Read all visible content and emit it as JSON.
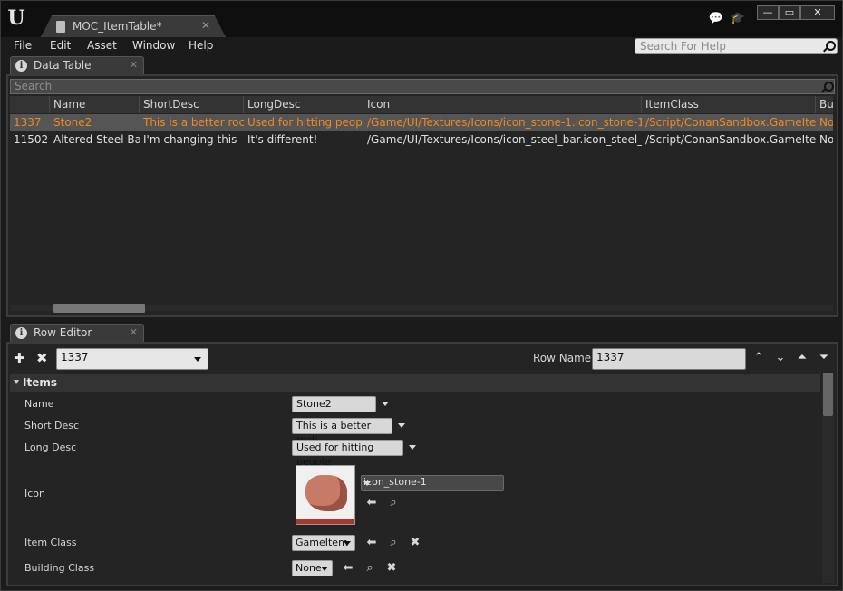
{
  "window": {
    "doc_tab": "MOC_ItemTable*",
    "controls": {
      "minimize": "—",
      "maximize": "▭",
      "close": "✕"
    }
  },
  "menu": [
    "File",
    "Edit",
    "Asset",
    "Window",
    "Help"
  ],
  "help_search": {
    "placeholder": "Search For Help"
  },
  "data_table": {
    "tab_label": "Data Table",
    "search_placeholder": "Search",
    "columns": [
      "",
      "Name",
      "ShortDesc",
      "LongDesc",
      "Icon",
      "ItemClass",
      "Bu"
    ],
    "rows": [
      [
        "1337",
        "Stone2",
        "This is a better rock",
        "Used for hitting people",
        "/Game/UI/Textures/Icons/icon_stone-1.icon_stone-1",
        "/Script/ConanSandbox.GameItem",
        "No"
      ],
      [
        "11502",
        "Altered Steel Bar",
        "I'm changing this",
        "It's different!",
        "/Game/UI/Textures/Icons/icon_steel_bar.icon_steel_bar",
        "/Script/ConanSandbox.GameItem",
        "No"
      ]
    ],
    "selected_row": 0
  },
  "row_editor": {
    "tab_label": "Row Editor",
    "row_select": "1337",
    "row_name_label": "Row Name:",
    "row_name_value": "1337",
    "category": "Items",
    "props": {
      "name": {
        "label": "Name",
        "value": "Stone2"
      },
      "short_desc": {
        "label": "Short Desc",
        "value": "This is a better rock"
      },
      "long_desc": {
        "label": "Long Desc",
        "value": "Used for hitting people"
      },
      "icon": {
        "label": "Icon",
        "value": "icon_stone-1"
      },
      "item_class": {
        "label": "Item Class",
        "value": "GameItem"
      },
      "building_class": {
        "label": "Building Class",
        "value": "None"
      }
    }
  },
  "colors": {
    "selected_text": "#f08a20",
    "panel_bg": "#242424"
  }
}
